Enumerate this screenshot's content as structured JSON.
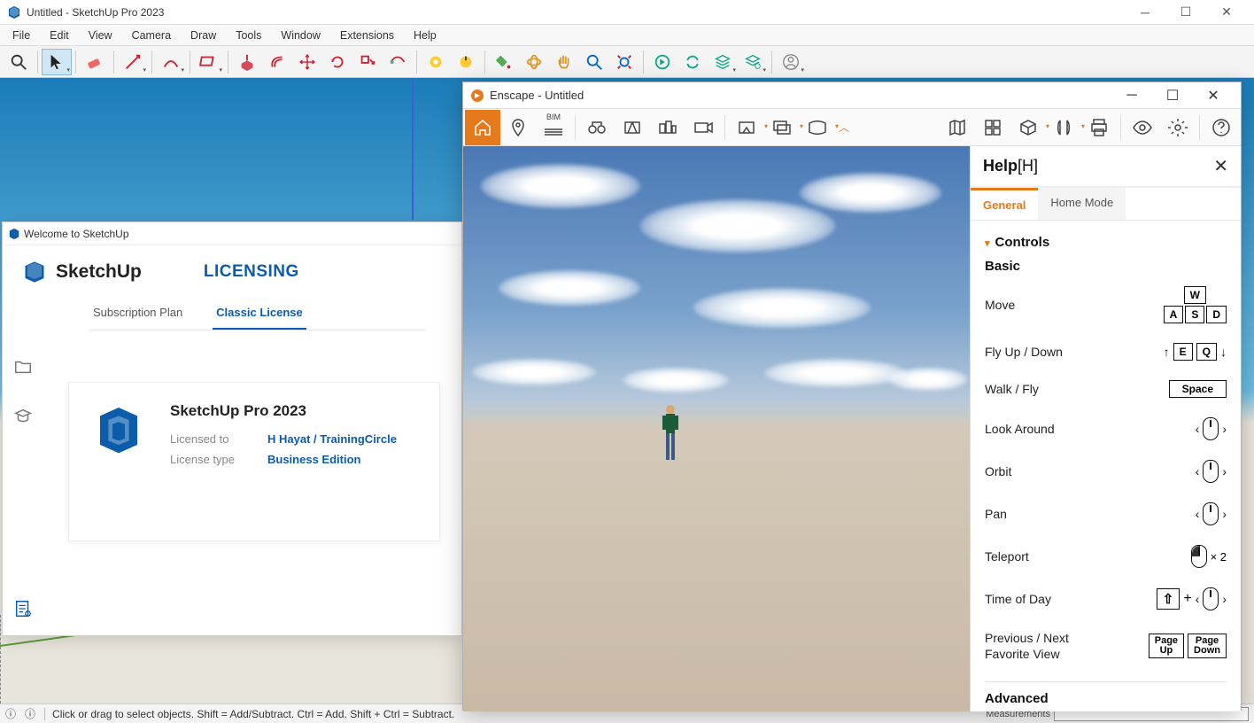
{
  "titleBar": {
    "title": "Untitled - SketchUp Pro 2023"
  },
  "menu": [
    "File",
    "Edit",
    "View",
    "Camera",
    "Draw",
    "Tools",
    "Window",
    "Extensions",
    "Help"
  ],
  "statusBar": {
    "hint": "Click or drag to select objects. Shift = Add/Subtract. Ctrl = Add. Shift + Ctrl = Subtract.",
    "measLabel": "Measurements"
  },
  "welcome": {
    "title": "Welcome to SketchUp",
    "brand": "SketchUp",
    "heading": "LICENSING",
    "tabs": {
      "sub": "Subscription Plan",
      "classic": "Classic License"
    },
    "card": {
      "product": "SketchUp Pro 2023",
      "licensedToLabel": "Licensed to",
      "licensedTo": "H Hayat / TrainingCircle",
      "licenseTypeLabel": "License type",
      "licenseType": "Business Edition"
    }
  },
  "enscape": {
    "title": "Enscape - Untitled",
    "bim": "BIM",
    "help": {
      "title": "Help",
      "shortcut": "[H]",
      "tabs": {
        "general": "General",
        "home": "Home Mode"
      },
      "section": "Controls",
      "sub": "Basic",
      "rows": {
        "move": "Move",
        "flyud": "Fly Up / Down",
        "walkfly": "Walk / Fly",
        "look": "Look Around",
        "orbit": "Orbit",
        "pan": "Pan",
        "teleport": "Teleport",
        "tod": "Time of Day",
        "pnfav": "Previous / Next Favorite View"
      },
      "keys": {
        "w": "W",
        "a": "A",
        "s": "S",
        "d": "D",
        "e": "E",
        "q": "Q",
        "space": "Space",
        "x2": "× 2",
        "plus": "+",
        "pu1": "Page",
        "pu2": "Up",
        "pd1": "Page",
        "pd2": "Down"
      },
      "advanced": "Advanced"
    }
  }
}
